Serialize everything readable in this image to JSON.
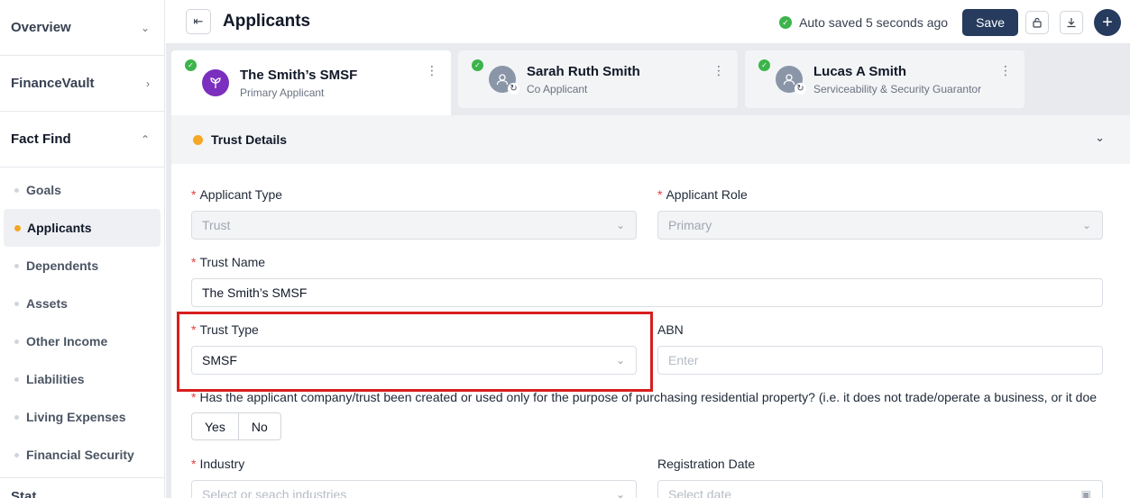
{
  "sidebar": {
    "overview": "Overview",
    "financevault": "FinanceVault",
    "factfind": "Fact Find",
    "items": [
      {
        "label": "Goals"
      },
      {
        "label": "Applicants"
      },
      {
        "label": "Dependents"
      },
      {
        "label": "Assets"
      },
      {
        "label": "Other Income"
      },
      {
        "label": "Liabilities"
      },
      {
        "label": "Living Expenses"
      },
      {
        "label": "Financial Security"
      }
    ],
    "next_section": "Stat..."
  },
  "header": {
    "title": "Applicants",
    "saved_text": "Auto saved 5 seconds ago",
    "save_label": "Save"
  },
  "tabs": [
    {
      "name": "The Smith’s SMSF",
      "role": "Primary Applicant"
    },
    {
      "name": "Sarah Ruth Smith",
      "role": "Co Applicant"
    },
    {
      "name": "Lucas A Smith",
      "role": "Serviceability & Security Guarantor"
    }
  ],
  "section": {
    "title": "Trust Details"
  },
  "form": {
    "applicant_type_label": "Applicant Type",
    "applicant_type_value": "Trust",
    "applicant_role_label": "Applicant Role",
    "applicant_role_value": "Primary",
    "trust_name_label": "Trust Name",
    "trust_name_value": "The Smith’s SMSF",
    "trust_type_label": "Trust Type",
    "trust_type_value": "SMSF",
    "abn_label": "ABN",
    "abn_placeholder": "Enter",
    "question": "Has the applicant company/trust been created or used only for the purpose of purchasing residential property? (i.e. it does not trade/operate a business, or it doe",
    "yes_label": "Yes",
    "no_label": "No",
    "industry_label": "Industry",
    "industry_placeholder": "Select or seach industries",
    "registration_label": "Registration Date",
    "registration_placeholder": "Select date"
  },
  "colors": {
    "accent": "#263b5e",
    "success": "#3cb44b",
    "warning": "#f5a623",
    "highlight": "#d81e1e"
  }
}
